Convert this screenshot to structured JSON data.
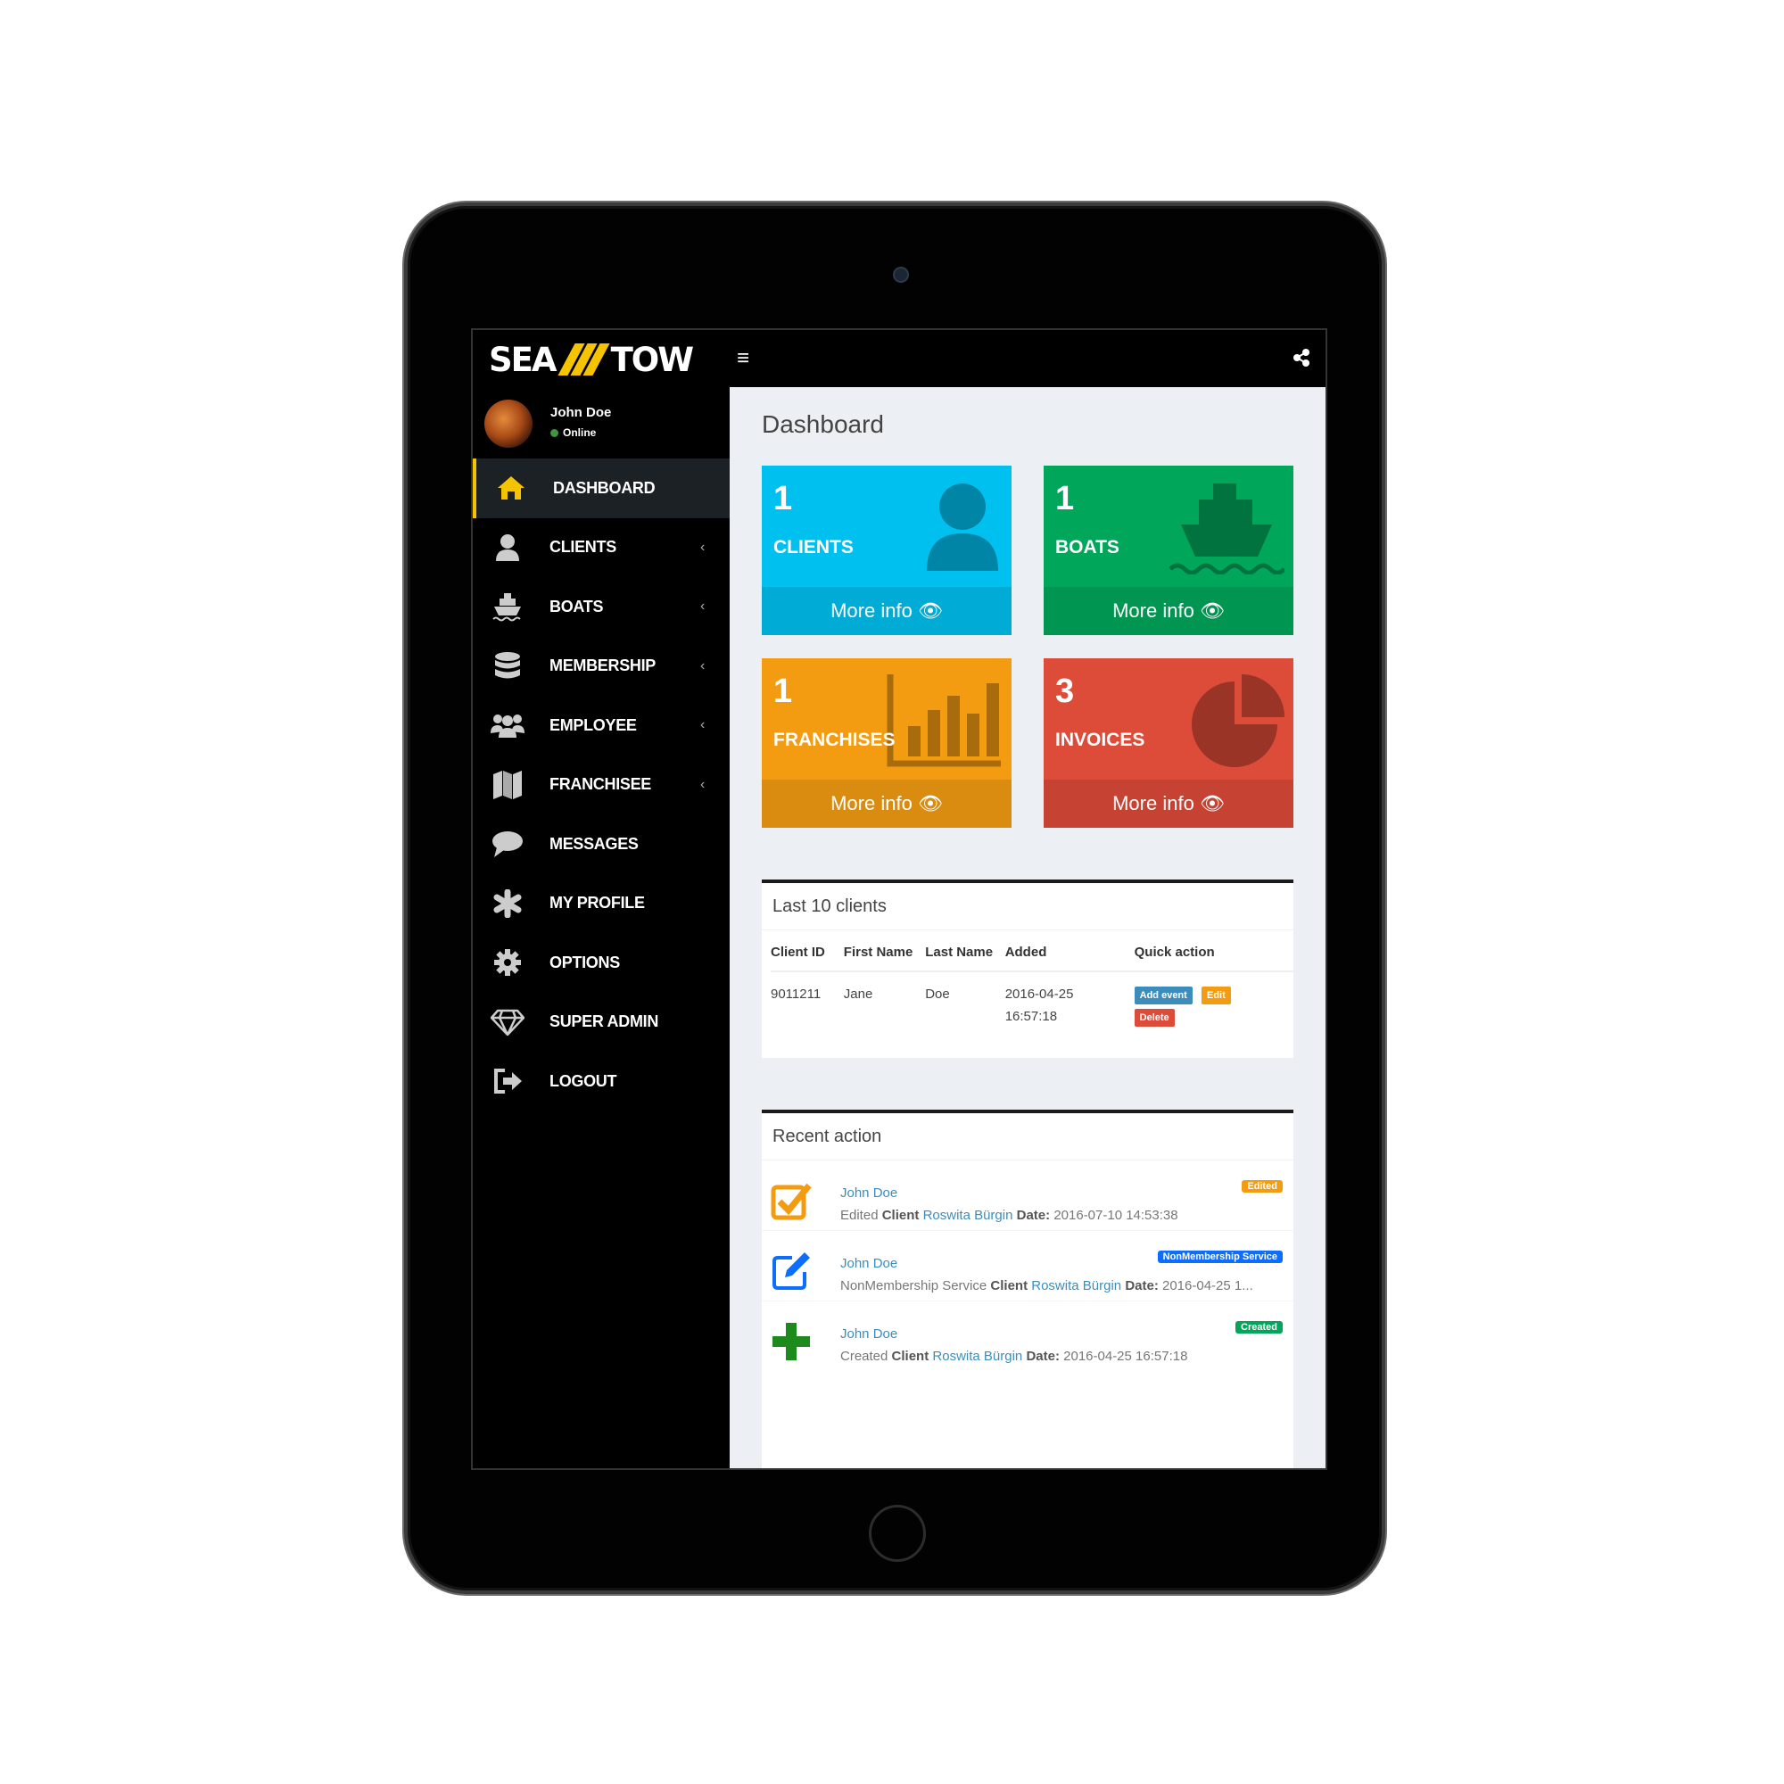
{
  "brand": {
    "logo_left": "SEA",
    "logo_right": "TOW",
    "accent": "#f5c400"
  },
  "user": {
    "name": "John Doe",
    "status": "Online"
  },
  "sidebar": {
    "items": [
      {
        "label": "DASHBOARD",
        "icon": "home-icon",
        "active": true
      },
      {
        "label": "CLIENTS",
        "icon": "user-icon",
        "chevron": "‹"
      },
      {
        "label": "BOATS",
        "icon": "ship-icon",
        "chevron": "‹"
      },
      {
        "label": "MEMBERSHIP",
        "icon": "database-icon",
        "chevron": "‹"
      },
      {
        "label": "EMPLOYEE",
        "icon": "users-icon",
        "chevron": "‹"
      },
      {
        "label": "FRANCHISEE",
        "icon": "map-icon",
        "chevron": "‹"
      },
      {
        "label": "MESSAGES",
        "icon": "comment-icon"
      },
      {
        "label": "MY PROFILE",
        "icon": "asterisk-icon"
      },
      {
        "label": "OPTIONS",
        "icon": "gear-icon"
      },
      {
        "label": "SUPER ADMIN",
        "icon": "diamond-icon"
      },
      {
        "label": "LOGOUT",
        "icon": "sign-out-icon"
      }
    ]
  },
  "page": {
    "title": "Dashboard"
  },
  "stats": [
    {
      "value": "1",
      "label": "CLIENTS",
      "more": "More info",
      "color": "#00c0ef"
    },
    {
      "value": "1",
      "label": "BOATS",
      "more": "More info",
      "color": "#00a65a"
    },
    {
      "value": "1",
      "label": "FRANCHISES",
      "more": "More info",
      "color": "#f39c12"
    },
    {
      "value": "3",
      "label": "INVOICES",
      "more": "More info",
      "color": "#dd4b39"
    }
  ],
  "clients": {
    "title": "Last 10 clients",
    "headers": [
      "Client ID",
      "First Name",
      "Last Name",
      "Added",
      "Quick action"
    ],
    "rows": [
      {
        "id": "9011211",
        "first": "Jane",
        "last": "Doe",
        "added_date": "2016-04-25",
        "added_time": "16:57:18"
      }
    ],
    "actions": {
      "add": "Add event",
      "edit": "Edit",
      "delete": "Delete"
    }
  },
  "recent": {
    "title": "Recent action",
    "items": [
      {
        "who": "John Doe",
        "prefix": "Edited",
        "client_word": "Client",
        "client": "Roswita Bürgin",
        "date_word": "Date:",
        "date": "2016-07-10 14:53:38",
        "badge": "Edited",
        "badge_color": "#f39c12",
        "icon": "check-square-icon"
      },
      {
        "who": "John Doe",
        "prefix": "NonMembership Service",
        "client_word": "Client",
        "client": "Roswita Bürgin",
        "date_word": "Date:",
        "date": "2016-04-25 1...",
        "badge": "NonMembership Service",
        "badge_color": "#0d6efd",
        "icon": "edit-icon"
      },
      {
        "who": "John Doe",
        "prefix": "Created",
        "client_word": "Client",
        "client": "Roswita Bürgin",
        "date_word": "Date:",
        "date": "2016-04-25 16:57:18",
        "badge": "Created",
        "badge_color": "#00a65a",
        "icon": "plus-icon"
      }
    ]
  }
}
